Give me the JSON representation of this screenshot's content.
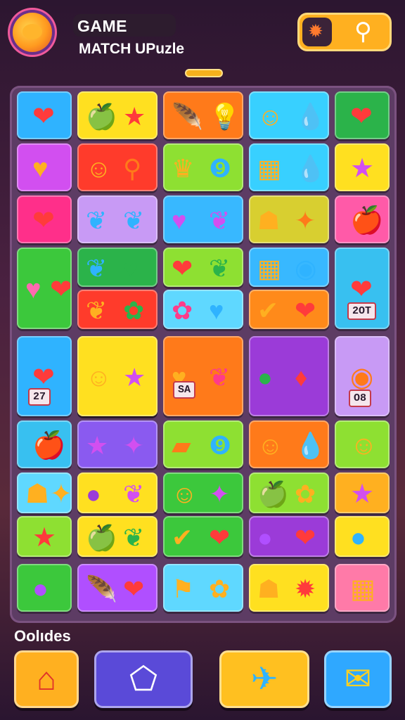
{
  "header": {
    "title_line1": "GAME",
    "title_line2": "MATCH UPuzle",
    "logo_icon": "sun-face-icon",
    "powerup_icons": [
      "rocket-icon",
      "magnifier-icon"
    ]
  },
  "board": {
    "tiles": [
      {
        "icons": [
          "❤"
        ],
        "colors": [
          "#ff3b3b"
        ],
        "bg": "#2fb3ff"
      },
      {
        "icons": [
          "🍏",
          "★"
        ],
        "colors": [
          "#2bb34a",
          "#ff3b3b"
        ],
        "bg": "#ffe020"
      },
      {
        "icons": [
          "🪶",
          "💡"
        ],
        "colors": [
          "#b04fff",
          "#2fb3ff"
        ],
        "bg": "#ff7a1a"
      },
      {
        "icons": [
          "☺",
          "💧"
        ],
        "colors": [
          "#ffb020",
          "#2bb34a"
        ],
        "bg": "#38d0ff"
      },
      {
        "icons": [
          "❤"
        ],
        "colors": [
          "#ff3b3b"
        ],
        "bg": "#2bb34a"
      },
      {
        "icons": [
          "♥"
        ],
        "colors": [
          "#ffb020"
        ],
        "bg": "#d24ff0"
      },
      {
        "icons": [
          "☺",
          "⚲"
        ],
        "colors": [
          "#ffb020",
          "#ff7a1a"
        ],
        "bg": "#ff3b2b"
      },
      {
        "icons": [
          "♛",
          "❾"
        ],
        "colors": [
          "#ffb020",
          "#2fb3ff"
        ],
        "bg": "#8ee032"
      },
      {
        "icons": [
          "▦",
          "💧"
        ],
        "colors": [
          "#ffb020",
          "#2bb34a"
        ],
        "bg": "#38d0ff"
      },
      {
        "icons": [
          "★"
        ],
        "colors": [
          "#d24ff0"
        ],
        "bg": "#ffe020"
      },
      {
        "icons": [
          "❤"
        ],
        "colors": [
          "#ff3b3b"
        ],
        "bg": "#ff2f8a"
      },
      {
        "icons": [
          "❦",
          "❦"
        ],
        "colors": [
          "#2fb3ff",
          "#2fb3ff"
        ],
        "bg": "#c89af5"
      },
      {
        "icons": [
          "♥",
          "❦"
        ],
        "colors": [
          "#d24ff0",
          "#d24ff0"
        ],
        "bg": "#38b8ff"
      },
      {
        "icons": [
          "☗",
          "✦"
        ],
        "colors": [
          "#ffb020",
          "#ff7a1a"
        ],
        "bg": "#d8cf30"
      },
      {
        "icons": [
          "🍎"
        ],
        "colors": [
          "#b04fff"
        ],
        "bg": "#ff5aa8"
      },
      {
        "icons": [
          "♥",
          "❤"
        ],
        "colors": [
          "#ff6ab0",
          "#ff3b3b"
        ],
        "bg": "#3cc83c"
      },
      {
        "icons": [
          "❦",
          "♥"
        ],
        "colors": [
          "#2fb3ff",
          "#2bb34a"
        ],
        "bg": "#2bb34a"
      },
      {
        "icons": [
          "❤",
          "❦"
        ],
        "colors": [
          "#ff3b3b",
          "#2bb34a"
        ],
        "bg": "#8ee032"
      },
      {
        "icons": [
          "▦",
          "◉"
        ],
        "colors": [
          "#ffb020",
          "#2fb3ff"
        ],
        "bg": "#38b8ff"
      },
      {
        "icons": [
          "❤"
        ],
        "colors": [
          "#ff3b3b"
        ],
        "bg": "#38c0f0"
      },
      {
        "icons": [
          "❦",
          "✿"
        ],
        "colors": [
          "#ffb020",
          "#2bb34a"
        ],
        "bg": "#ff3b2b"
      },
      {
        "icons": [
          "✿",
          "♥"
        ],
        "colors": [
          "#ff3b8a",
          "#2fb3ff"
        ],
        "bg": "#5fd8ff"
      },
      {
        "icons": [
          "✔",
          "❤"
        ],
        "colors": [
          "#ffb020",
          "#ff3b3b"
        ],
        "bg": "#ff8a1a"
      },
      {
        "icons": [
          "❤"
        ],
        "colors": [
          "#ff3b3b"
        ],
        "bg": "#2fb3ff"
      },
      {
        "icons": [
          "♥",
          "❦"
        ],
        "colors": [
          "#ff3b3b",
          "#ff3b8a"
        ],
        "bg": "#ffe020"
      },
      {
        "icons": [
          "☺",
          "★"
        ],
        "colors": [
          "#ffb020",
          "#d24ff0"
        ],
        "bg": "#ffe020"
      },
      {
        "icons": [
          "♥",
          "❦"
        ],
        "colors": [
          "#ffb020",
          "#ff3b8a"
        ],
        "bg": "#ff7a1a"
      },
      {
        "icons": [
          "●",
          "♦"
        ],
        "colors": [
          "#2bb34a",
          "#ff3b3b"
        ],
        "bg": "#9b3bd8"
      },
      {
        "icons": [
          "◉"
        ],
        "colors": [
          "#ff7a1a"
        ],
        "bg": "#c89af5"
      },
      {
        "icons": [
          "🍎"
        ],
        "colors": [
          "#b04fff"
        ],
        "bg": "#38c0f0"
      },
      {
        "icons": [
          "★",
          "✦"
        ],
        "colors": [
          "#d24ff0",
          "#d24ff0"
        ],
        "bg": "#8a5af0"
      },
      {
        "icons": [
          "▰",
          "❾"
        ],
        "colors": [
          "#ff7a1a",
          "#2fb3ff"
        ],
        "bg": "#8ee032"
      },
      {
        "icons": [
          "☺",
          "💧"
        ],
        "colors": [
          "#ffb020",
          "#2fb3ff"
        ],
        "bg": "#ff7a1a"
      },
      {
        "icons": [
          "☺"
        ],
        "colors": [
          "#ffb020"
        ],
        "bg": "#8ee032"
      },
      {
        "icons": [
          "☗",
          "✦"
        ],
        "colors": [
          "#ffb020",
          "#ffb020"
        ],
        "bg": "#5fd8ff"
      },
      {
        "icons": [
          "●",
          "❦"
        ],
        "colors": [
          "#9b3bd8",
          "#d24ff0"
        ],
        "bg": "#ffe020"
      },
      {
        "icons": [
          "☺",
          "✦"
        ],
        "colors": [
          "#ffb020",
          "#d24ff0"
        ],
        "bg": "#3cc83c"
      },
      {
        "icons": [
          "🍏",
          "✿"
        ],
        "colors": [
          "#2bb34a",
          "#ffb020"
        ],
        "bg": "#8ee032"
      },
      {
        "icons": [
          "★"
        ],
        "colors": [
          "#d24ff0"
        ],
        "bg": "#ffb020"
      },
      {
        "icons": [
          "★"
        ],
        "colors": [
          "#ff3b3b"
        ],
        "bg": "#8ee032"
      },
      {
        "icons": [
          "🍏",
          "❦"
        ],
        "colors": [
          "#2bb34a",
          "#2bb34a"
        ],
        "bg": "#ffe020"
      },
      {
        "icons": [
          "✔",
          "❤"
        ],
        "colors": [
          "#ffb020",
          "#ff3b3b"
        ],
        "bg": "#3cc83c"
      },
      {
        "icons": [
          "●",
          "❤"
        ],
        "colors": [
          "#b04fff",
          "#ff3b3b"
        ],
        "bg": "#9b3bd8"
      },
      {
        "icons": [
          "●"
        ],
        "colors": [
          "#2fb3ff"
        ],
        "bg": "#ffe020"
      },
      {
        "icons": [
          "●"
        ],
        "colors": [
          "#b04fff"
        ],
        "bg": "#3cc83c"
      },
      {
        "icons": [
          "🪶",
          "❤"
        ],
        "colors": [
          "#b04fff",
          "#ff3b3b"
        ],
        "bg": "#b04fff"
      },
      {
        "icons": [
          "⚑",
          "✿"
        ],
        "colors": [
          "#ffb020",
          "#ffb020"
        ],
        "bg": "#5fd8ff"
      },
      {
        "icons": [
          "☗",
          "✹"
        ],
        "colors": [
          "#ffb020",
          "#ff3b3b"
        ],
        "bg": "#ffe020"
      },
      {
        "icons": [
          "▦"
        ],
        "colors": [
          "#ffb020"
        ],
        "bg": "#ff7aa8"
      }
    ],
    "labels": [
      {
        "text": "2OT"
      },
      {
        "text": "27"
      },
      {
        "text": "SA"
      },
      {
        "text": "O8"
      }
    ]
  },
  "footer": {
    "title": "Oolıdes",
    "buttons": [
      {
        "icon": "home-icon",
        "glyph": "⌂",
        "color": "#e0322a"
      },
      {
        "icon": "puzzle-piece-icon",
        "glyph": "⬠",
        "color": "#ffffff"
      },
      {
        "icon": "rocket-icon",
        "glyph": "✈",
        "color": "#2fb3ff"
      },
      {
        "icon": "envelope-icon",
        "glyph": "✉",
        "color": "#ffd020"
      }
    ]
  }
}
